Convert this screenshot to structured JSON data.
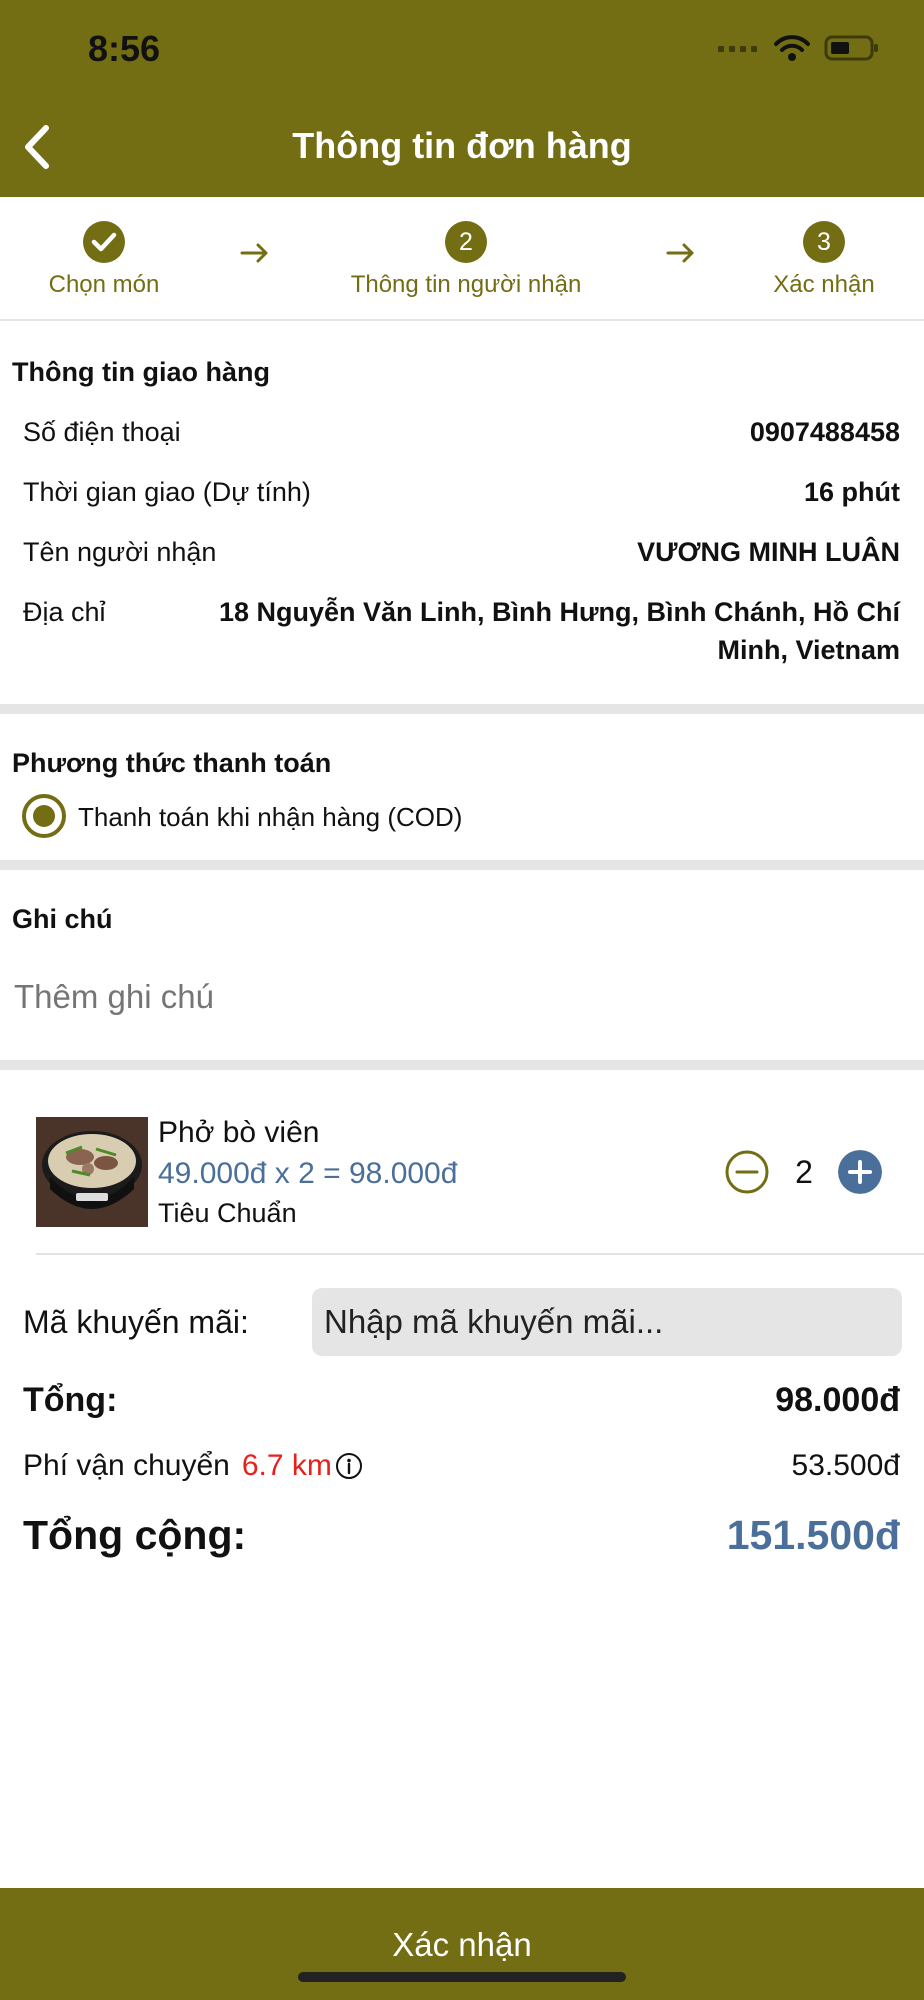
{
  "status_bar": {
    "time": "8:56"
  },
  "header": {
    "title": "Thông tin đơn hàng"
  },
  "steps": [
    {
      "number": "",
      "label": "Chọn món"
    },
    {
      "number": "2",
      "label": "Thông tin người nhận"
    },
    {
      "number": "3",
      "label": "Xác nhận"
    }
  ],
  "delivery": {
    "title": "Thông tin giao hàng",
    "phone_label": "Số điện thoại",
    "phone_value": "0907488458",
    "time_label": "Thời gian giao (Dự tính)",
    "time_value": "16 phút",
    "name_label": "Tên người nhận",
    "name_value": "VƯƠNG MINH LUÂN",
    "address_label": "Địa chỉ",
    "address_line1": "18 Nguyễn Văn Linh, Bình Hưng, Bình Chánh, Hồ Chí",
    "address_line2": "Minh, Vietnam"
  },
  "payment": {
    "title": "Phương thức thanh toán",
    "option_label": "Thanh toán khi nhận hàng (COD)"
  },
  "note": {
    "title": "Ghi chú",
    "placeholder": "Thêm ghi chú"
  },
  "item": {
    "name": "Phở bò viên",
    "price_line": "49.000đ x 2 = 98.000đ",
    "size": "Tiêu Chuẩn",
    "quantity": "2"
  },
  "summary": {
    "promo_label": "Mã khuyến mãi:",
    "promo_placeholder": "Nhập mã khuyến mãi...",
    "subtotal_label": "Tổng:",
    "subtotal_value": "98.000đ",
    "shipping_label": "Phí vận chuyển",
    "shipping_distance": "6.7 km",
    "shipping_value": "53.500đ",
    "total_label": "Tổng cộng:",
    "total_value": "151.500đ"
  },
  "footer": {
    "confirm_label": "Xác nhận"
  },
  "colors": {
    "brand": "#736d14",
    "accent_blue": "#4a6f9a",
    "distance_red": "#e8201a"
  }
}
